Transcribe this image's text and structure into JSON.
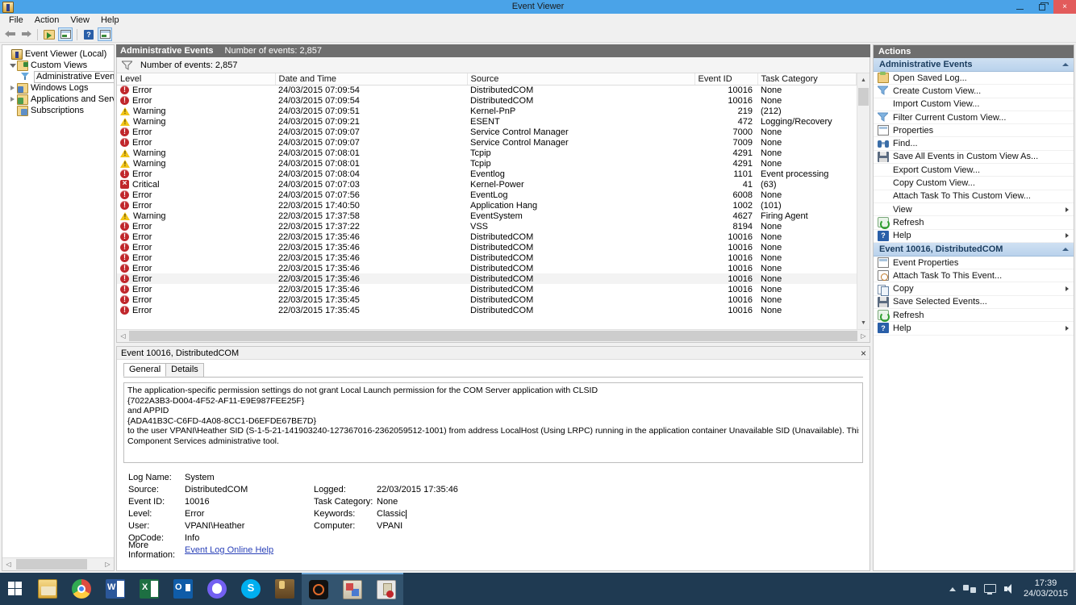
{
  "window": {
    "title": "Event Viewer",
    "icon": "event-viewer-icon",
    "controls": {
      "minimize": "–",
      "maximize": "❐",
      "close": "×"
    }
  },
  "menubar": {
    "items": [
      "File",
      "Action",
      "View",
      "Help"
    ]
  },
  "toolbar": {
    "buttons": [
      {
        "name": "back-button",
        "icon": "arrow-left-icon"
      },
      {
        "name": "forward-button",
        "icon": "arrow-right-icon"
      },
      {
        "name": "show-hide-console-tree-button",
        "icon": "folder-arrow-icon"
      },
      {
        "name": "show-hide-action-pane-button",
        "icon": "window-pane-icon",
        "pressed": true
      },
      {
        "name": "help-button",
        "icon": "help-icon"
      },
      {
        "name": "show-hide-preview-pane-button",
        "icon": "window-pane-icon",
        "pressed": true
      }
    ]
  },
  "tree": {
    "nodes": [
      {
        "label": "Event Viewer (Local)",
        "icon": "event-viewer-icon",
        "indent": 0,
        "expander": "none",
        "selected": false
      },
      {
        "label": "Custom Views",
        "icon": "folder-green-icon",
        "indent": 1,
        "expander": "open",
        "selected": false
      },
      {
        "label": "Administrative Events",
        "icon": "filter-icon",
        "indent": 2,
        "expander": "none",
        "selected": true
      },
      {
        "label": "Windows Logs",
        "icon": "folder-blue-icon",
        "indent": 1,
        "expander": "closed",
        "selected": false
      },
      {
        "label": "Applications and Services Lo",
        "icon": "folder-green2-icon",
        "indent": 1,
        "expander": "closed",
        "selected": false
      },
      {
        "label": "Subscriptions",
        "icon": "subscriptions-icon",
        "indent": 1,
        "expander": "none",
        "selected": false
      }
    ]
  },
  "center": {
    "header": {
      "title": "Administrative Events",
      "count": "Number of events: 2,857"
    },
    "filterbar": {
      "icon": "filter-icon",
      "text": "Number of events: 2,857"
    },
    "columns": [
      "Level",
      "Date and Time",
      "Source",
      "Event ID",
      "Task Category"
    ],
    "rows": [
      {
        "level": "Error",
        "icon": "error-icon",
        "datetime": "24/03/2015 07:09:54",
        "source": "DistributedCOM",
        "event_id": "10016",
        "task": "None",
        "selected": false
      },
      {
        "level": "Error",
        "icon": "error-icon",
        "datetime": "24/03/2015 07:09:54",
        "source": "DistributedCOM",
        "event_id": "10016",
        "task": "None",
        "selected": false
      },
      {
        "level": "Warning",
        "icon": "warning-icon",
        "datetime": "24/03/2015 07:09:51",
        "source": "Kernel-PnP",
        "event_id": "219",
        "task": "(212)",
        "selected": false
      },
      {
        "level": "Warning",
        "icon": "warning-icon",
        "datetime": "24/03/2015 07:09:21",
        "source": "ESENT",
        "event_id": "472",
        "task": "Logging/Recovery",
        "selected": false
      },
      {
        "level": "Error",
        "icon": "error-icon",
        "datetime": "24/03/2015 07:09:07",
        "source": "Service Control Manager",
        "event_id": "7000",
        "task": "None",
        "selected": false
      },
      {
        "level": "Error",
        "icon": "error-icon",
        "datetime": "24/03/2015 07:09:07",
        "source": "Service Control Manager",
        "event_id": "7009",
        "task": "None",
        "selected": false
      },
      {
        "level": "Warning",
        "icon": "warning-icon",
        "datetime": "24/03/2015 07:08:01",
        "source": "Tcpip",
        "event_id": "4291",
        "task": "None",
        "selected": false
      },
      {
        "level": "Warning",
        "icon": "warning-icon",
        "datetime": "24/03/2015 07:08:01",
        "source": "Tcpip",
        "event_id": "4291",
        "task": "None",
        "selected": false
      },
      {
        "level": "Error",
        "icon": "error-icon",
        "datetime": "24/03/2015 07:08:04",
        "source": "Eventlog",
        "event_id": "1101",
        "task": "Event processing",
        "selected": false
      },
      {
        "level": "Critical",
        "icon": "critical-icon",
        "datetime": "24/03/2015 07:07:03",
        "source": "Kernel-Power",
        "event_id": "41",
        "task": "(63)",
        "selected": false
      },
      {
        "level": "Error",
        "icon": "error-icon",
        "datetime": "24/03/2015 07:07:56",
        "source": "EventLog",
        "event_id": "6008",
        "task": "None",
        "selected": false
      },
      {
        "level": "Error",
        "icon": "error-icon",
        "datetime": "22/03/2015 17:40:50",
        "source": "Application Hang",
        "event_id": "1002",
        "task": "(101)",
        "selected": false
      },
      {
        "level": "Warning",
        "icon": "warning-icon",
        "datetime": "22/03/2015 17:37:58",
        "source": "EventSystem",
        "event_id": "4627",
        "task": "Firing Agent",
        "selected": false
      },
      {
        "level": "Error",
        "icon": "error-icon",
        "datetime": "22/03/2015 17:37:22",
        "source": "VSS",
        "event_id": "8194",
        "task": "None",
        "selected": false
      },
      {
        "level": "Error",
        "icon": "error-icon",
        "datetime": "22/03/2015 17:35:46",
        "source": "DistributedCOM",
        "event_id": "10016",
        "task": "None",
        "selected": false
      },
      {
        "level": "Error",
        "icon": "error-icon",
        "datetime": "22/03/2015 17:35:46",
        "source": "DistributedCOM",
        "event_id": "10016",
        "task": "None",
        "selected": false
      },
      {
        "level": "Error",
        "icon": "error-icon",
        "datetime": "22/03/2015 17:35:46",
        "source": "DistributedCOM",
        "event_id": "10016",
        "task": "None",
        "selected": false
      },
      {
        "level": "Error",
        "icon": "error-icon",
        "datetime": "22/03/2015 17:35:46",
        "source": "DistributedCOM",
        "event_id": "10016",
        "task": "None",
        "selected": false
      },
      {
        "level": "Error",
        "icon": "error-icon",
        "datetime": "22/03/2015 17:35:46",
        "source": "DistributedCOM",
        "event_id": "10016",
        "task": "None",
        "selected": true
      },
      {
        "level": "Error",
        "icon": "error-icon",
        "datetime": "22/03/2015 17:35:46",
        "source": "DistributedCOM",
        "event_id": "10016",
        "task": "None",
        "selected": false
      },
      {
        "level": "Error",
        "icon": "error-icon",
        "datetime": "22/03/2015 17:35:45",
        "source": "DistributedCOM",
        "event_id": "10016",
        "task": "None",
        "selected": false
      },
      {
        "level": "Error",
        "icon": "error-icon",
        "datetime": "22/03/2015 17:35:45",
        "source": "DistributedCOM",
        "event_id": "10016",
        "task": "None",
        "selected": false
      }
    ]
  },
  "detail": {
    "title": "Event 10016, DistributedCOM",
    "close_label": "×",
    "tabs": [
      {
        "label": "General",
        "active": true
      },
      {
        "label": "Details",
        "active": false
      }
    ],
    "message_lines": [
      "The application-specific permission settings do not grant Local Launch permission for the COM Server application with CLSID",
      "{7022A3B3-D004-4F52-AF11-E9E987FEE25F}",
      " and APPID",
      "{ADA41B3C-C6FD-4A08-8CC1-D6EFDE67BE7D}",
      " to the user VPANI\\Heather SID (S-1-5-21-141903240-127367016-2362059512-1001) from address LocalHost (Using LRPC) running in the application container Unavailable SID (Unavailable). This security permission can be modified using the",
      "Component Services administrative tool."
    ],
    "fields": {
      "log_name_label": "Log Name:",
      "log_name_value": "System",
      "source_label": "Source:",
      "source_value": "DistributedCOM",
      "logged_label": "Logged:",
      "logged_value": "22/03/2015 17:35:46",
      "event_id_label": "Event ID:",
      "event_id_value": "10016",
      "task_category_label": "Task Category:",
      "task_category_value": "None",
      "level_label": "Level:",
      "level_value": "Error",
      "keywords_label": "Keywords:",
      "keywords_value": "Classic",
      "user_label": "User:",
      "user_value": "VPANI\\Heather",
      "computer_label": "Computer:",
      "computer_value": "VPANI",
      "opcode_label": "OpCode:",
      "opcode_value": "Info",
      "more_info_label": "More Information:",
      "more_info_link": "Event Log Online Help"
    }
  },
  "actions": {
    "header": "Actions",
    "groups": [
      {
        "title": "Administrative Events",
        "items": [
          {
            "label": "Open Saved Log...",
            "icon": "open-folder-icon",
            "submenu": false
          },
          {
            "label": "Create Custom View...",
            "icon": "filter-icon",
            "submenu": false
          },
          {
            "label": "Import Custom View...",
            "icon": "none",
            "submenu": false
          },
          {
            "label": "Filter Current Custom View...",
            "icon": "filter-icon",
            "submenu": false
          },
          {
            "label": "Properties",
            "icon": "properties-icon",
            "submenu": false
          },
          {
            "label": "Find...",
            "icon": "binoculars-icon",
            "submenu": false
          },
          {
            "label": "Save All Events in Custom View As...",
            "icon": "save-icon",
            "submenu": false
          },
          {
            "label": "Export Custom View...",
            "icon": "none",
            "submenu": false
          },
          {
            "label": "Copy Custom View...",
            "icon": "none",
            "submenu": false
          },
          {
            "label": "Attach Task To This Custom View...",
            "icon": "none",
            "submenu": false
          },
          {
            "label": "View",
            "icon": "none",
            "submenu": true
          },
          {
            "label": "Refresh",
            "icon": "refresh-icon",
            "submenu": false
          },
          {
            "label": "Help",
            "icon": "help-icon",
            "submenu": true
          }
        ]
      },
      {
        "title": "Event 10016, DistributedCOM",
        "items": [
          {
            "label": "Event Properties",
            "icon": "properties-icon",
            "submenu": false
          },
          {
            "label": "Attach Task To This Event...",
            "icon": "clock-icon",
            "submenu": false
          },
          {
            "label": "Copy",
            "icon": "copy-icon",
            "submenu": true
          },
          {
            "label": "Save Selected Events...",
            "icon": "save-icon",
            "submenu": false
          },
          {
            "label": "Refresh",
            "icon": "refresh-icon",
            "submenu": false
          },
          {
            "label": "Help",
            "icon": "help-icon",
            "submenu": true
          }
        ]
      }
    ]
  },
  "taskbar": {
    "start": {
      "name": "start-button",
      "icon": "windows-logo-icon"
    },
    "items": [
      {
        "name": "file-explorer",
        "icon": "file-explorer-icon",
        "active": false
      },
      {
        "name": "google-chrome",
        "icon": "chrome-icon",
        "active": false
      },
      {
        "name": "microsoft-word",
        "icon": "word-icon",
        "active": false
      },
      {
        "name": "microsoft-excel",
        "icon": "excel-icon",
        "active": false
      },
      {
        "name": "microsoft-outlook",
        "icon": "outlook-icon",
        "active": false
      },
      {
        "name": "viber",
        "icon": "viber-icon",
        "active": false
      },
      {
        "name": "skype",
        "icon": "skype-icon",
        "active": false
      },
      {
        "name": "paint",
        "icon": "paint-icon",
        "active": false
      },
      {
        "name": "camera-app",
        "icon": "camera-icon",
        "active": true
      },
      {
        "name": "colorful-app",
        "icon": "app-icon",
        "active": true
      },
      {
        "name": "event-viewer",
        "icon": "event-viewer-icon",
        "active": true
      }
    ],
    "tray": {
      "show_hidden": "chevron-up-icon",
      "network": "network-icon",
      "display": "monitor-icon",
      "volume": "speaker-icon",
      "time": "17:39",
      "date": "24/03/2015"
    }
  },
  "colors": {
    "titlebar": "#4aa3e8",
    "close_button": "#e25b5b",
    "pane_header": "#6e6e6e",
    "group_header": "#bcd4ed",
    "error": "#c0262b",
    "warning": "#f2c518",
    "link": "#2a41b8",
    "taskbar": "#1f3a52",
    "selection": "#f3f3f3"
  }
}
